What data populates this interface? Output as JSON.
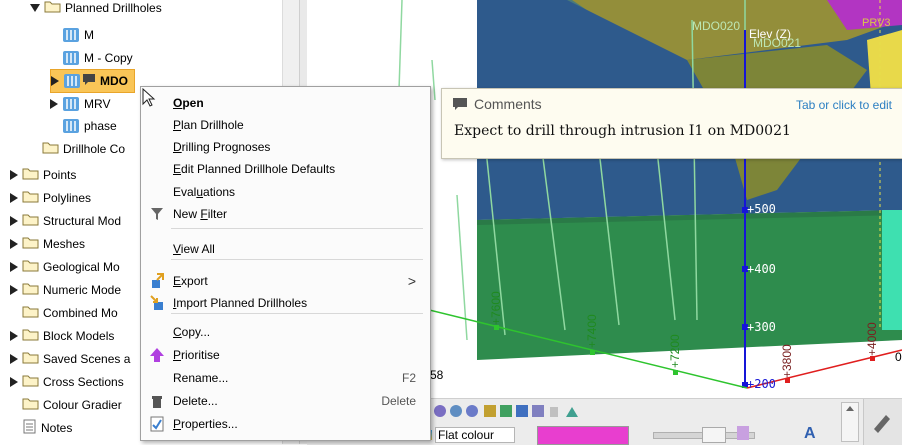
{
  "tree": {
    "items": [
      {
        "label": "Planned Drillholes",
        "expand": "down",
        "kind": "folder"
      },
      {
        "label": "M",
        "expand": "none",
        "kind": "drillhole"
      },
      {
        "label": "M - Copy",
        "expand": "none",
        "kind": "drillhole"
      },
      {
        "label": "MDO",
        "expand": "right",
        "kind": "drillhole-selected"
      },
      {
        "label": "MRV",
        "expand": "right",
        "kind": "drillhole"
      },
      {
        "label": "phase",
        "expand": "none",
        "kind": "drillhole"
      },
      {
        "label": "Drillhole Co",
        "expand": "none",
        "kind": "folder"
      },
      {
        "label": "Points",
        "expand": "right",
        "kind": "folder"
      },
      {
        "label": "Polylines",
        "expand": "right",
        "kind": "folder"
      },
      {
        "label": "Structural Mod",
        "expand": "right",
        "kind": "folder"
      },
      {
        "label": "Meshes",
        "expand": "right",
        "kind": "folder"
      },
      {
        "label": "Geological Mo",
        "expand": "right",
        "kind": "folder"
      },
      {
        "label": "Numeric Mode",
        "expand": "right",
        "kind": "folder"
      },
      {
        "label": "Combined Mo",
        "expand": "none",
        "kind": "folder"
      },
      {
        "label": "Block Models",
        "expand": "right",
        "kind": "folder"
      },
      {
        "label": "Saved Scenes a",
        "expand": "right",
        "kind": "folder"
      },
      {
        "label": "Cross Sections",
        "expand": "right",
        "kind": "folder"
      },
      {
        "label": "Colour Gradier",
        "expand": "none",
        "kind": "folder"
      },
      {
        "label": "Notes",
        "expand": "none",
        "kind": "notes"
      }
    ]
  },
  "context_menu": {
    "items": [
      {
        "label": "Open",
        "underline": "O",
        "bold": true,
        "icon": "",
        "shortcut": ""
      },
      {
        "label": "Plan Drillhole",
        "underline": "P",
        "icon": "",
        "shortcut": ""
      },
      {
        "label": "Drilling Prognoses",
        "underline": "D",
        "icon": "",
        "shortcut": ""
      },
      {
        "label": "Edit Planned Drillhole Defaults",
        "underline": "E",
        "icon": "",
        "shortcut": ""
      },
      {
        "label": "Evaluations",
        "underline": "u",
        "icon": "",
        "shortcut": ""
      },
      {
        "label": "New Filter",
        "underline": "F",
        "icon": "filter-icon",
        "shortcut": ""
      },
      {
        "label": "View All",
        "underline": "V",
        "icon": "",
        "shortcut": ""
      },
      {
        "label": "Export",
        "underline": "E",
        "icon": "export-icon",
        "shortcut": ">"
      },
      {
        "label": "Import Planned Drillholes",
        "underline": "I",
        "icon": "import-icon",
        "shortcut": ""
      },
      {
        "label": "Copy...",
        "underline": "C",
        "icon": "",
        "shortcut": ""
      },
      {
        "label": "Prioritise",
        "underline": "P",
        "icon": "up-arrow-icon",
        "shortcut": ""
      },
      {
        "label": "Rename...",
        "underline": "",
        "icon": "",
        "shortcut": "F2"
      },
      {
        "label": "Delete...",
        "underline": "",
        "icon": "delete-icon",
        "shortcut": "Delete"
      },
      {
        "label": "Properties...",
        "underline": "P",
        "icon": "properties-icon",
        "shortcut": ""
      }
    ]
  },
  "comments": {
    "title": "Comments",
    "hint": "Tab or click to edit",
    "text": "Expect to drill through intrusion I1 on MD0021"
  },
  "scene": {
    "hole_labels": [
      "MDO020",
      "MDO021"
    ],
    "elev_label": "Elev (Z)",
    "elev_ticks": [
      "+500",
      "+400",
      "+300",
      "+200"
    ],
    "x_ticks": [
      "+7600",
      "+7400",
      "+7200"
    ],
    "red_ticks": [
      "+3800",
      "+4000"
    ],
    "partial_labels": [
      "58",
      "0"
    ],
    "corner_label": "PRV3"
  },
  "toolbar": {
    "colour_mode": "Flat colour"
  }
}
